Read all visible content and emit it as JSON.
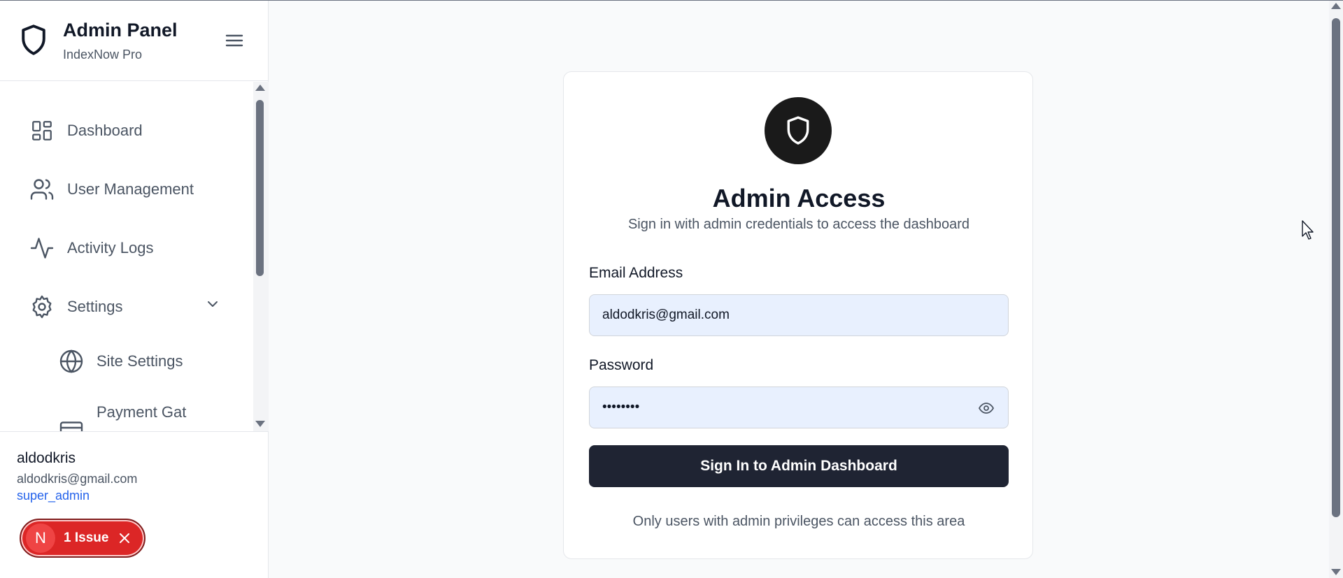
{
  "sidebar": {
    "title": "Admin Panel",
    "subtitle": "IndexNow Pro",
    "logo_icon": "shield-icon",
    "menu_icon": "hamburger-icon",
    "nav": [
      {
        "label": "Dashboard",
        "icon": "layout-dashboard-icon"
      },
      {
        "label": "User Management",
        "icon": "users-icon"
      },
      {
        "label": "Activity Logs",
        "icon": "activity-icon"
      },
      {
        "label": "Settings",
        "icon": "gear-icon",
        "expanded": true
      },
      {
        "label": "Site Settings",
        "icon": "globe-icon"
      },
      {
        "label": "Payment Gat",
        "icon": "credit-card-icon"
      }
    ],
    "user": {
      "name": "aldodkris",
      "email": "aldodkris@gmail.com",
      "role": "super_admin"
    },
    "issue_badge": {
      "letter": "N",
      "text": "1 Issue"
    }
  },
  "login": {
    "title": "Admin Access",
    "subtitle": "Sign in with admin credentials to access the dashboard",
    "email_label": "Email Address",
    "email_value": "aldodkris@gmail.com",
    "password_label": "Password",
    "password_value": "••••••••",
    "submit_label": "Sign In to Admin Dashboard",
    "footer_note": "Only users with admin privileges can access this area"
  },
  "colors": {
    "accent_dark": "#1f2433",
    "role_link": "#2563eb",
    "issue_red": "#dc2626",
    "input_bg": "#e8f0fe"
  }
}
